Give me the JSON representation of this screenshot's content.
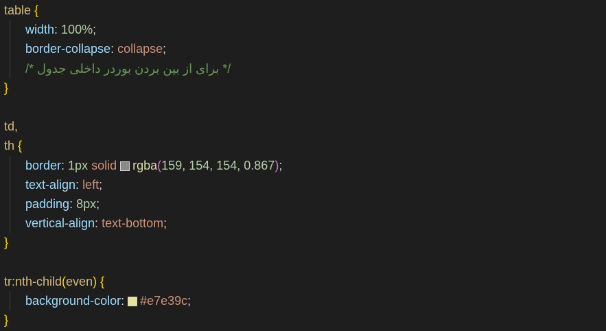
{
  "colors": {
    "background": "#1e1e1e",
    "swatch_border": "#9f9a9add",
    "swatch_bg": "#e7e39c"
  },
  "rules": [
    {
      "selectors": [
        "table {"
      ],
      "declarations": [
        {
          "prop": "width",
          "value": "100%"
        },
        {
          "prop": "border-collapse",
          "value": "collapse"
        }
      ],
      "comment": "/* برای از بین بردن بوردر داخلی جدول */"
    },
    {
      "selectors": [
        "td,",
        "th {"
      ],
      "declarations": [
        {
          "prop": "border",
          "value_parts": [
            "1px",
            "solid",
            "rgba",
            "(",
            "159, 154, 154, 0.867",
            ")"
          ]
        },
        {
          "prop": "text-align",
          "value": "left"
        },
        {
          "prop": "padding",
          "value": "8px"
        },
        {
          "prop": "vertical-align",
          "value": "text-bottom"
        }
      ]
    },
    {
      "selectors": [
        "tr:nth-child(even) {"
      ],
      "declarations": [
        {
          "prop": "background-color",
          "value": "#e7e39c"
        }
      ]
    }
  ],
  "text": {
    "l1_sel": "table",
    "l1_brace": "{",
    "l2_prop": "width",
    "l2_colon": ": ",
    "l2_val": "100%",
    "l2_semi": ";",
    "l3_prop": "border-collapse",
    "l3_colon": ": ",
    "l3_val": "collapse",
    "l3_semi": ";",
    "l4_comment": "/* برای از بین بردن بوردر داخلی جدول */",
    "l5_brace": "}",
    "l7_sel": "td,",
    "l8_sel": "th",
    "l8_brace": "{",
    "l9_prop": "border",
    "l9_colon": ": ",
    "l9_num": "1px",
    "l9_kw": "solid",
    "l9_fn": "rgba",
    "l9_open": "(",
    "l9_args": "159, 154, 154, 0.867",
    "l9_close": ")",
    "l9_semi": ";",
    "l10_prop": "text-align",
    "l10_colon": ": ",
    "l10_val": "left",
    "l10_semi": ";",
    "l11_prop": "padding",
    "l11_colon": ": ",
    "l11_val": "8px",
    "l11_semi": ";",
    "l12_prop": "vertical-align",
    "l12_colon": ": ",
    "l12_val": "text-bottom",
    "l12_semi": ";",
    "l13_brace": "}",
    "l15_sel": "tr:nth-child",
    "l15_open": "(",
    "l15_arg": "even",
    "l15_close": ")",
    "l15_brace": "{",
    "l16_prop": "background-color",
    "l16_colon": ": ",
    "l16_val": "#e7e39c",
    "l16_semi": ";",
    "l17_brace": "}"
  }
}
